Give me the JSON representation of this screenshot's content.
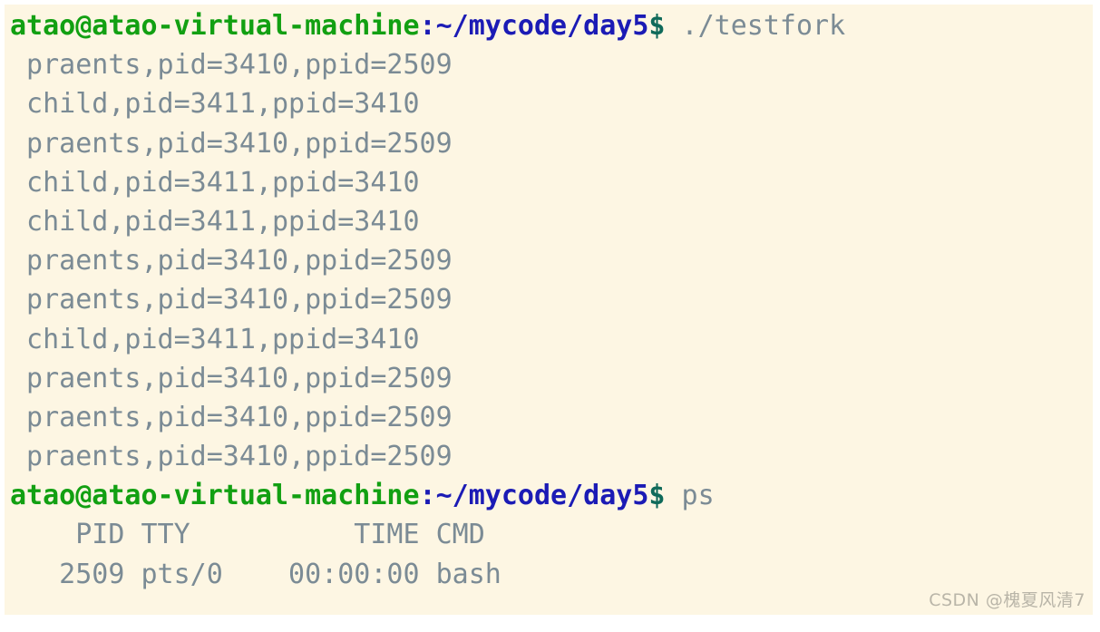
{
  "terminal": {
    "background_color": "#fdf6e3",
    "prompt_user_color": "#12a012",
    "prompt_path_color": "#1b1bb5",
    "output_color": "#7b8b95",
    "prompt": {
      "user_host": "atao@atao-virtual-machine",
      "colon": ":",
      "path": "~/mycode/day5",
      "symbol": "$"
    },
    "lines": [
      {
        "type": "prompt",
        "user_host": "atao@atao-virtual-machine",
        "colon": ":",
        "path": "~/mycode/day5",
        "symbol": "$",
        "command": " ./testfork"
      },
      {
        "type": "output",
        "text": " praents,pid=3410,ppid=2509"
      },
      {
        "type": "output",
        "text": " child,pid=3411,ppid=3410"
      },
      {
        "type": "output",
        "text": " praents,pid=3410,ppid=2509"
      },
      {
        "type": "output",
        "text": " child,pid=3411,ppid=3410"
      },
      {
        "type": "output",
        "text": " child,pid=3411,ppid=3410"
      },
      {
        "type": "output",
        "text": " praents,pid=3410,ppid=2509"
      },
      {
        "type": "output",
        "text": " praents,pid=3410,ppid=2509"
      },
      {
        "type": "output",
        "text": " child,pid=3411,ppid=3410"
      },
      {
        "type": "output",
        "text": " praents,pid=3410,ppid=2509"
      },
      {
        "type": "output",
        "text": " praents,pid=3410,ppid=2509"
      },
      {
        "type": "output",
        "text": " praents,pid=3410,ppid=2509"
      },
      {
        "type": "prompt",
        "user_host": "atao@atao-virtual-machine",
        "colon": ":",
        "path": "~/mycode/day5",
        "symbol": "$",
        "command": " ps"
      },
      {
        "type": "output",
        "text": "    PID TTY          TIME CMD"
      },
      {
        "type": "output",
        "text": "   2509 pts/0    00:00:00 bash"
      }
    ],
    "ps_table": {
      "headers": [
        "PID",
        "TTY",
        "TIME",
        "CMD"
      ],
      "rows": [
        [
          "2509",
          "pts/0",
          "00:00:00",
          "bash"
        ]
      ]
    }
  },
  "watermark": {
    "text": "CSDN @槐夏风清7"
  }
}
